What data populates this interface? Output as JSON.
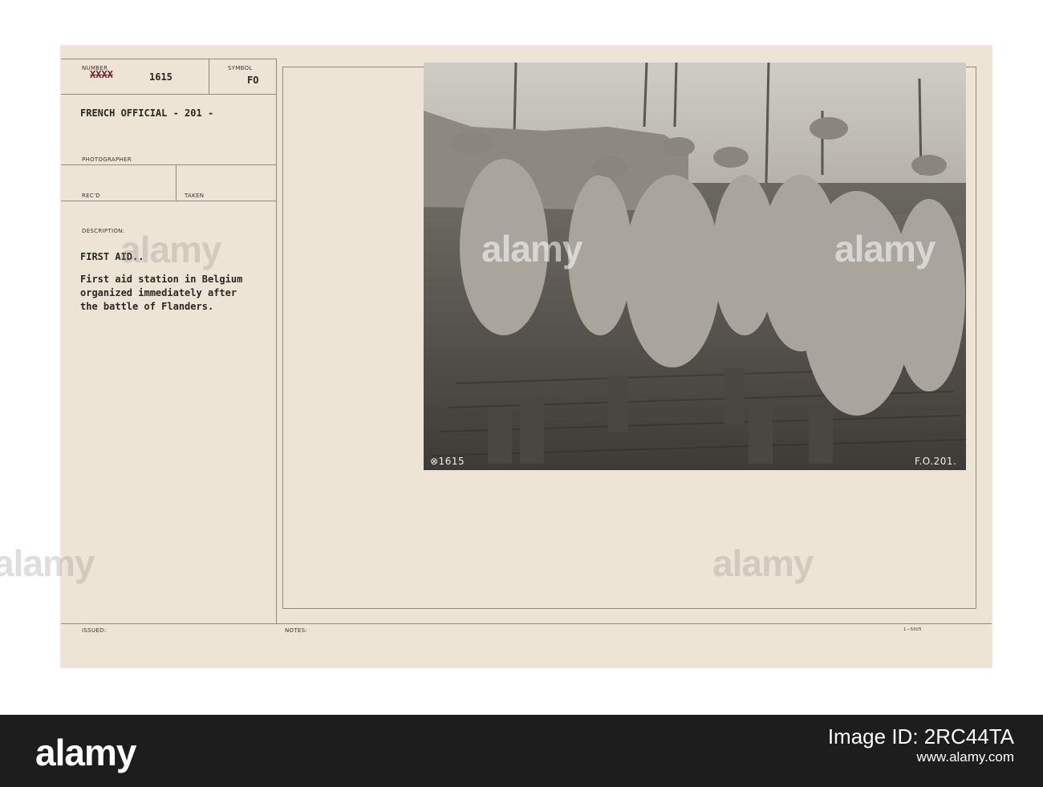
{
  "card": {
    "number_label": "NUMBER",
    "number_struck": "XXXX",
    "number_value": "1615",
    "symbol_label": "SYMBOL",
    "symbol_value": "FO",
    "source_line": "FRENCH OFFICIAL - 201 -",
    "photographer_label": "PHOTOGRAPHER",
    "recd_label": "REC'D",
    "taken_label": "TAKEN",
    "description_label": "DESCRIPTION:",
    "description_title": "FIRST AID..",
    "description_lines": [
      "First aid station in Belgium",
      "organized immediately after",
      "the battle of Flanders."
    ],
    "issued_label": "ISSUED:",
    "notes_label": "NOTES:",
    "form_code": "1—5005"
  },
  "photo": {
    "caption_left": "⊗1615",
    "caption_right": "F.O.201."
  },
  "watermarks": [
    "alamy",
    "alamy",
    "alamy",
    "alamy",
    "alamy"
  ],
  "footer": {
    "brand": "alamy",
    "image_id_label": "Image ID: 2RC44TA",
    "site": "www.alamy.com"
  }
}
